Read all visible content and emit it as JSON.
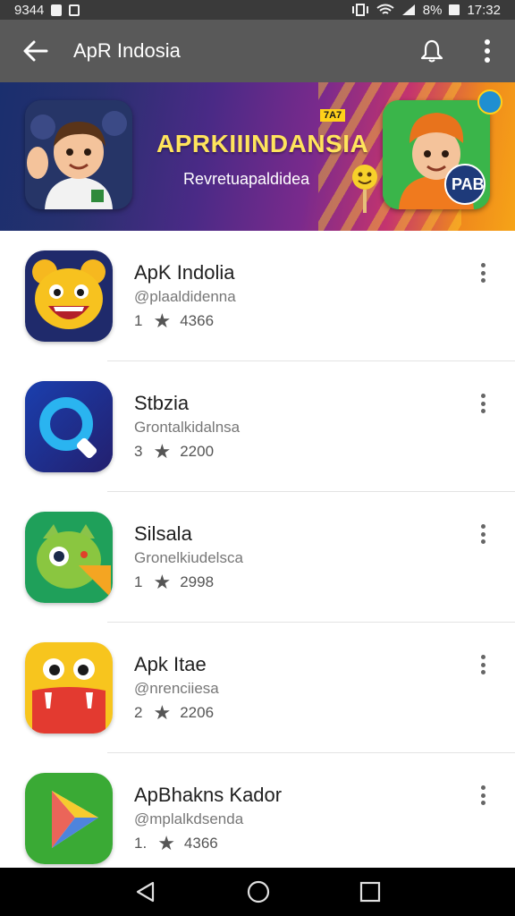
{
  "status_bar": {
    "left_text": "9344",
    "battery": "8%",
    "time": "17:32"
  },
  "app_bar": {
    "title": "ApR Indosia"
  },
  "banner": {
    "title": "APRKIIINDANSIA",
    "subtitle": "Revretuapaldidea",
    "tag": "7A7",
    "badge": "PAB"
  },
  "apps": [
    {
      "name": "ApK Indolia",
      "developer": "@plaaldidenna",
      "rating": "1",
      "count": "4366",
      "icon": "yellow-bear-icon",
      "color": "#1f2a6b"
    },
    {
      "name": "Stbzia",
      "developer": "Grontalkidalnsa",
      "rating": "3",
      "count": "2200",
      "icon": "magnifier-icon",
      "color": "#1a3a9c"
    },
    {
      "name": "Silsala",
      "developer": "Gronelkiudelsca",
      "rating": "1",
      "count": "2998",
      "icon": "green-monster-icon",
      "color": "#2fa55a"
    },
    {
      "name": "Apk Itae",
      "developer": "@nrenciiesa",
      "rating": "2",
      "count": "2206",
      "icon": "yellow-monster-icon",
      "color": "#f7c51e"
    },
    {
      "name": "ApBhakns Kador",
      "developer": "@mplalkdsenda",
      "rating": "1.",
      "count": "4366",
      "icon": "play-triangle-icon",
      "color": "#3aaa35"
    }
  ],
  "colors": {
    "app_bar": "#595959",
    "status_bar": "#3a3a3a",
    "nav_bar": "#000000"
  }
}
